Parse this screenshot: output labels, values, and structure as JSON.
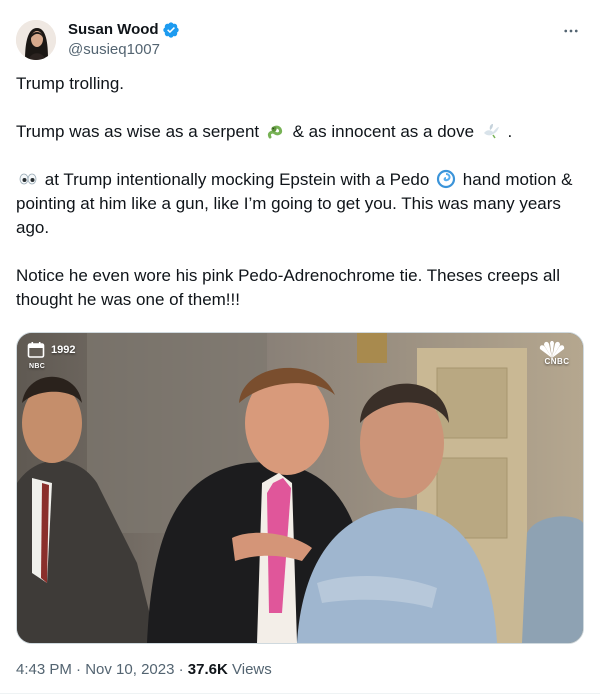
{
  "author": {
    "display_name": "Susan Wood",
    "handle": "@susieq1007",
    "verified": true
  },
  "more_icon": "more-horizontal-icon",
  "tweet": {
    "line1": "Trump trolling.",
    "line2_a": "Trump was as wise as a serpent",
    "line2_b": "& as innocent as a dove",
    "line2_c": ".",
    "line3_a": "at Trump intentionally mocking Epstein with a Pedo",
    "line3_b": "hand motion & pointing at him like a gun, like I’m going to get you. This was many years ago.",
    "line4": "Notice he even wore his pink Pedo-Adrenochrome tie. Theses creeps all thought he was one of them!!!"
  },
  "media": {
    "year_label": "1992",
    "source_label": "NBC",
    "network_label": "CNBC"
  },
  "footer": {
    "time": "4:43 PM",
    "sep1": "·",
    "date": "Nov 10, 2023",
    "sep2": "·",
    "views_count": "37.6K",
    "views_label": "Views"
  },
  "colors": {
    "text_primary": "#0f1419",
    "text_secondary": "#536471",
    "verified_blue": "#1d9bf0",
    "tie_pink": "#e0569a"
  }
}
